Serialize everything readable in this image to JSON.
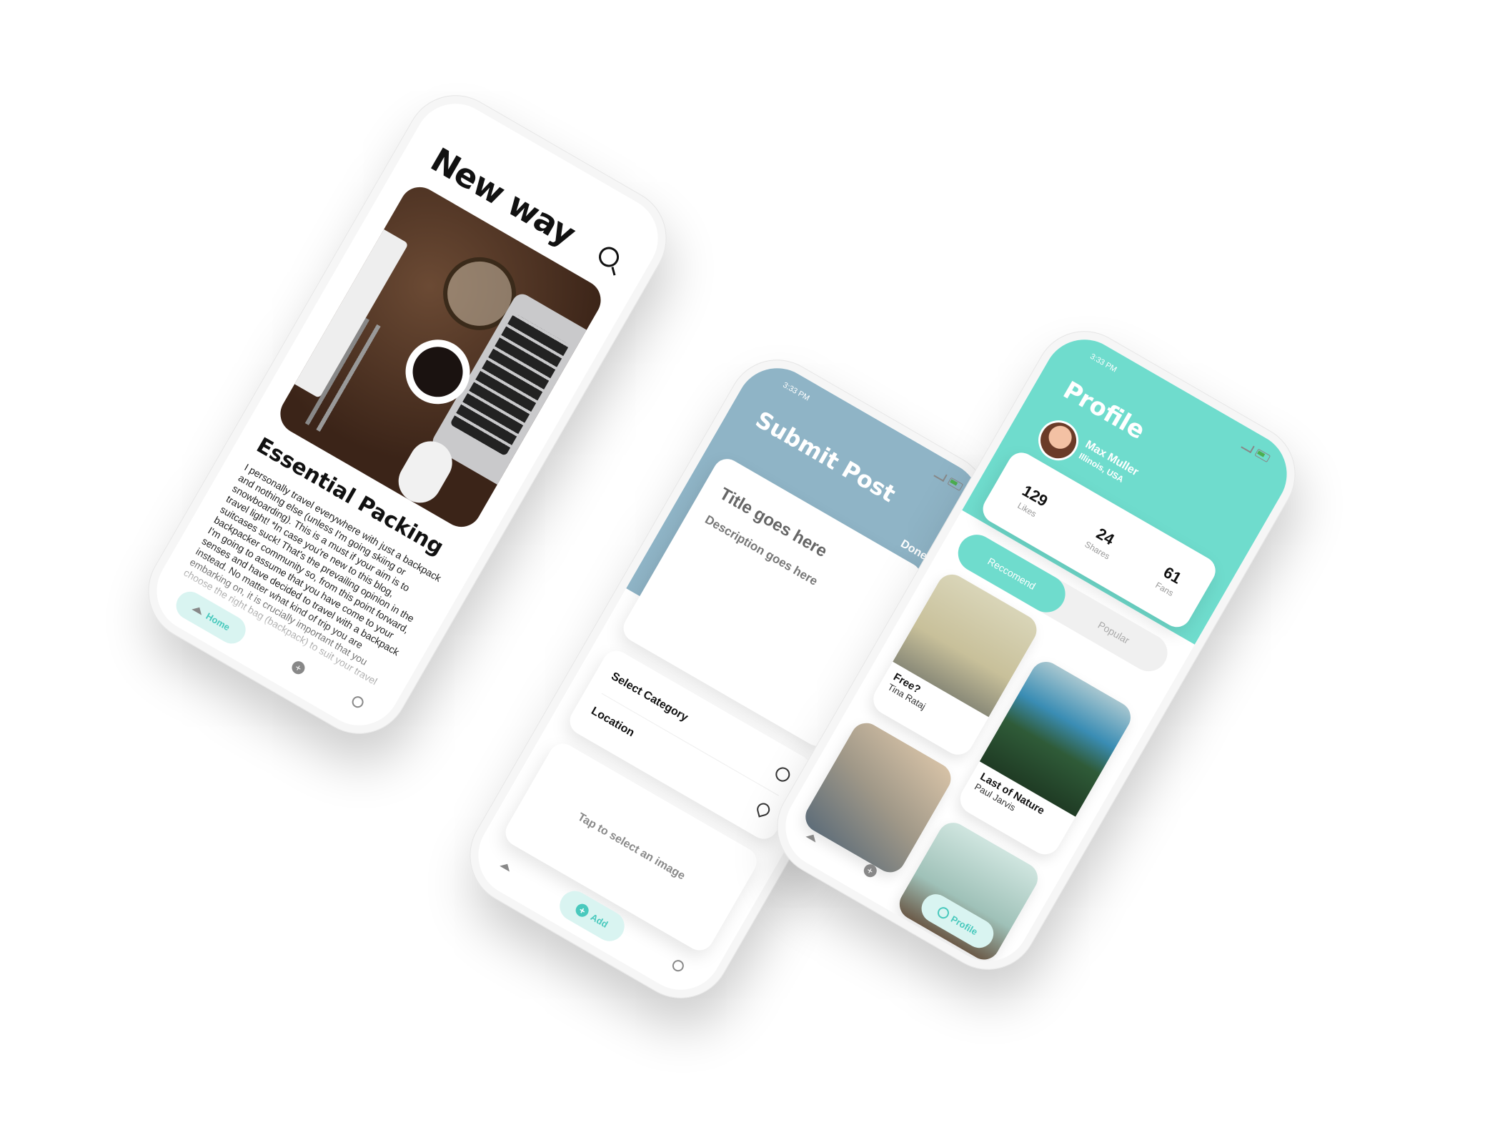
{
  "feed": {
    "title": "New way",
    "article_title": "Essential Packing",
    "article_body": "I personally travel everywhere with just a backpack and nothing else (unless I'm going skiing or snowboarding). This is a must if your aim is to travel light! *In case you're new to this blog, suitcases suck! That's the prevailing opinion in the backpacker community so, from this point forward, I'm going to assume that you have come to your senses and have decided to travel with a backpack instead. No matter what kind of trip you are embarking on, it is crucially important that you choose the right bag (backpack) to suit your travel",
    "nav": {
      "home_label": "Home"
    }
  },
  "submit": {
    "status_time": "3:33 PM",
    "title": "Submit Post",
    "done_label": "Done",
    "title_placeholder": "Title goes here",
    "description_placeholder": "Description goes here",
    "category_label": "Select Category",
    "location_label": "Location",
    "image_prompt": "Tap to select an image",
    "nav": {
      "add_label": "Add"
    }
  },
  "profile": {
    "status_time": "3:33 PM",
    "title": "Profile",
    "name": "Max Muller",
    "location": "Illinois, USA",
    "stats": [
      {
        "value": "129",
        "label": "Likes"
      },
      {
        "value": "24",
        "label": "Shares"
      },
      {
        "value": "61",
        "label": "Fans"
      }
    ],
    "tabs": [
      "Reccomend",
      "Popular"
    ],
    "posts": [
      {
        "title": "Free?",
        "author": "Tina Rataj"
      },
      {
        "title": "Last of Nature",
        "author": "Paul Jarvis"
      }
    ],
    "nav": {
      "profile_label": "Profile"
    }
  },
  "colors": {
    "accent_teal": "#6fdccd",
    "submit_blue": "#8fb4c6"
  }
}
